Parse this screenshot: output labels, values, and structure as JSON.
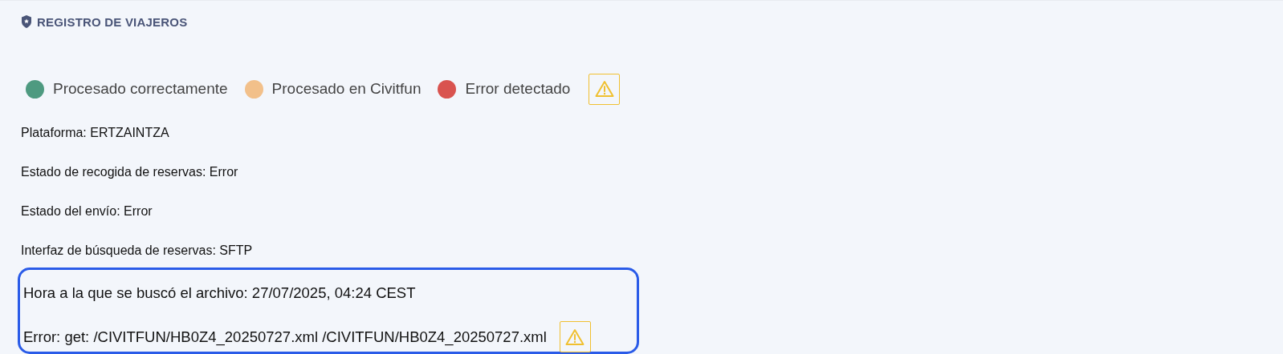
{
  "header": {
    "title": "REGISTRO DE VIAJEROS"
  },
  "legend": {
    "items": [
      {
        "label": "Procesado correctamente",
        "color": "#4e9a80"
      },
      {
        "label": "Procesado en Civitfun",
        "color": "#f2c08a"
      },
      {
        "label": "Error detectado",
        "color": "#d9534f"
      }
    ],
    "warning": true
  },
  "details": [
    "Plataforma: ERTZAINTZA",
    "Estado de recogida de reservas: Error",
    "Estado del envío: Error",
    "Interfaz de búsqueda de reservas: SFTP"
  ],
  "highlighted": {
    "lines": [
      {
        "text": "Hora a la que se buscó el archivo: 27/07/2025, 04:24 CEST",
        "warning": false
      },
      {
        "text": "Error: get: /CIVITFUN/HB0Z4_20250727.xml /CIVITFUN/HB0Z4_20250727.xml",
        "warning": true
      }
    ]
  }
}
